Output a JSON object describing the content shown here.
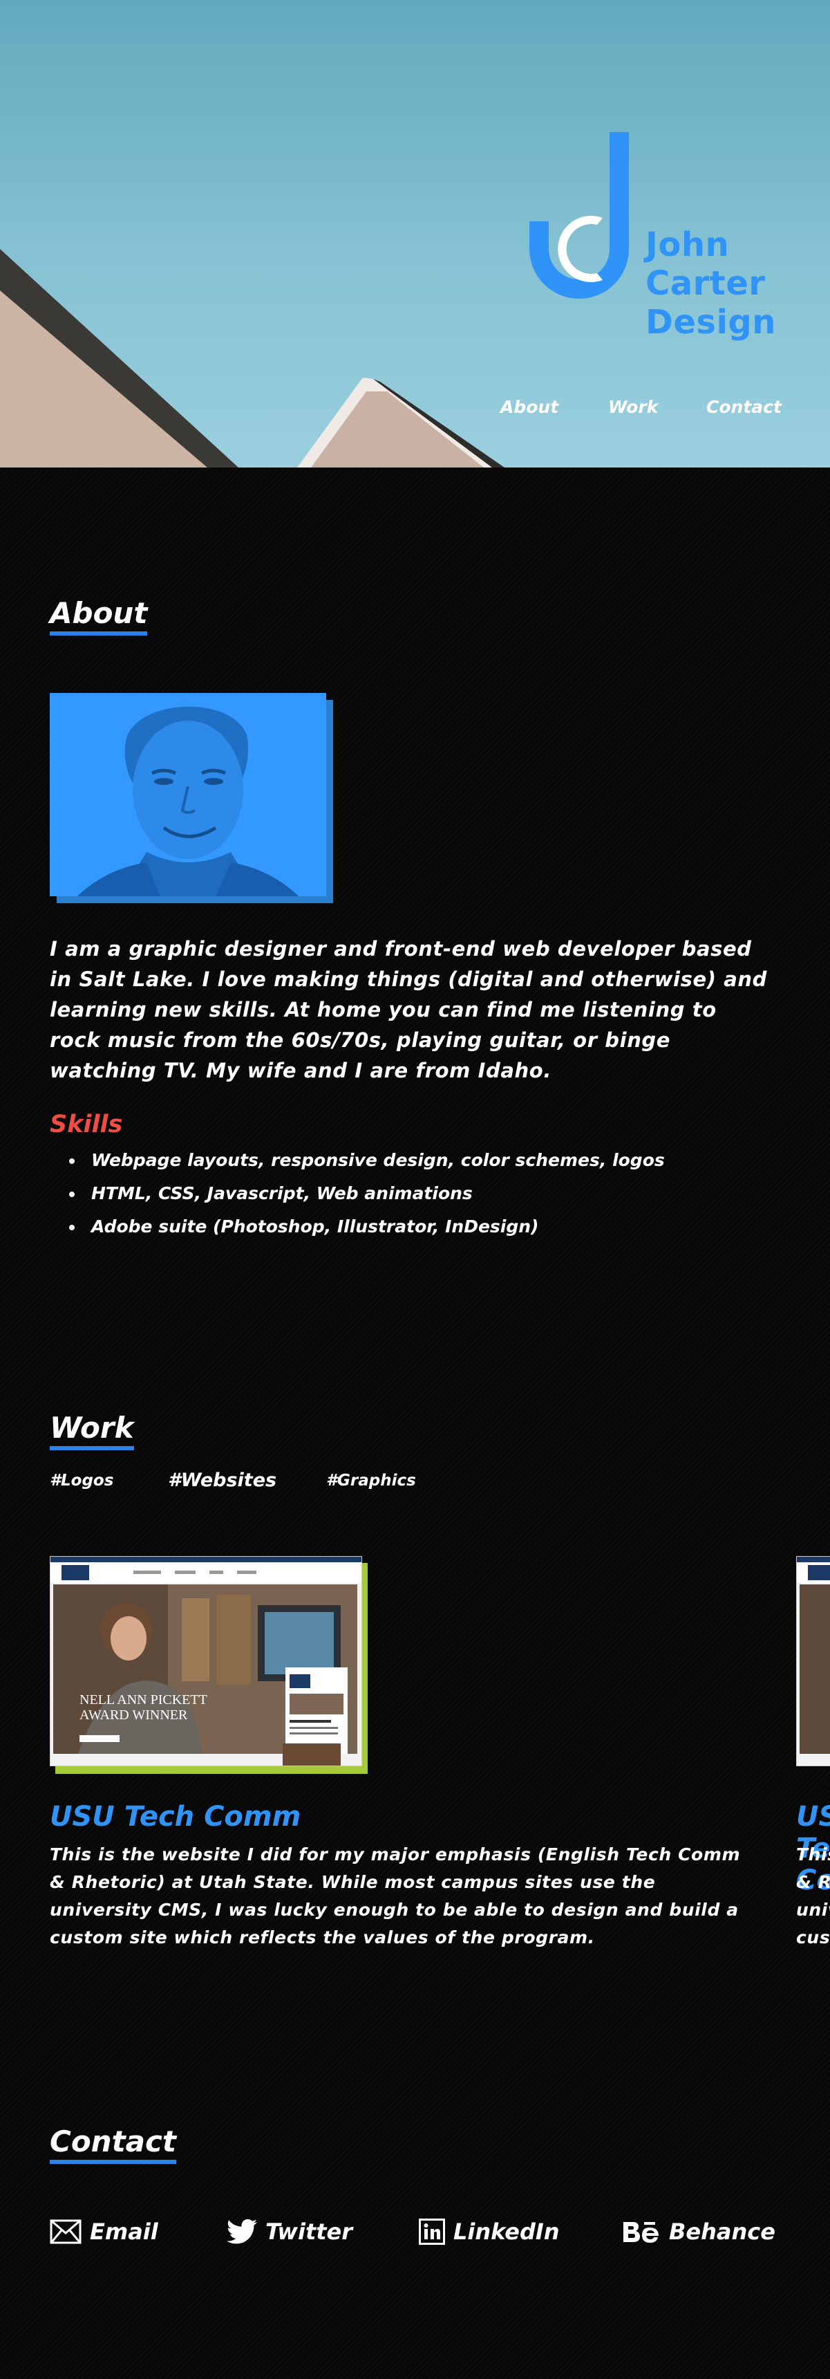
{
  "brand": {
    "line1": "John",
    "line2": "Carter",
    "line3": "Design"
  },
  "nav": {
    "about": "About",
    "work": "Work",
    "contact": "Contact"
  },
  "about": {
    "heading": "About",
    "bio": "I am a graphic designer and front-end web developer based in Salt Lake. I love making things (digital and otherwise) and learning new skills. At home you can find me listening to rock music from the 60s/70s, playing guitar, or binge watching TV. My wife and I are from Idaho.",
    "skills_title": "Skills",
    "skills": [
      "Webpage layouts, responsive design, color schemes, logos",
      "HTML, CSS, Javascript, Web animations",
      "Adobe suite (Photoshop, Illustrator, InDesign)"
    ]
  },
  "work": {
    "heading": "Work",
    "tags": [
      "#Logos",
      "#Websites",
      "#Graphics"
    ],
    "projects": [
      {
        "title": "USU Tech Comm",
        "description": "This is the website I did for my major emphasis (English Tech Comm & Rhetoric) at Utah State. While most campus sites use the university CMS, I was lucky enough to be able to design and build a custom site which reflects the values of the program.",
        "screenshot_headline_1": "NELL ANN PICKETT",
        "screenshot_headline_2": "AWARD WINNER"
      }
    ]
  },
  "contact": {
    "heading": "Contact",
    "links": [
      {
        "label": "Email",
        "icon": "envelope-icon"
      },
      {
        "label": "Twitter",
        "icon": "twitter-bird-icon"
      },
      {
        "label": "LinkedIn",
        "icon": "linkedin-icon"
      },
      {
        "label": "Behance",
        "icon": "behance-icon"
      }
    ]
  },
  "colors": {
    "accent_blue": "#2f93f7",
    "skills_red": "#ef4e45",
    "underline_blue": "#2a83e9",
    "card_green": "#a6c93a"
  }
}
